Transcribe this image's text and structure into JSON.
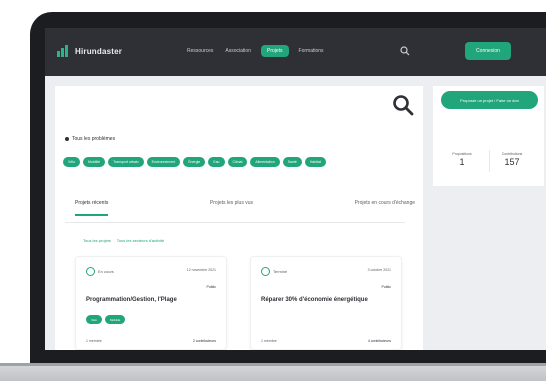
{
  "brand": {
    "name": "Hirundaster"
  },
  "nav": {
    "items": [
      "Ressources",
      "Association",
      "Projets",
      "Formations"
    ],
    "active_index": 2,
    "cta_label": "Connexion"
  },
  "main": {
    "theme_label": "Tous les problèmes",
    "chips": [
      "Vélo",
      "Mobilité",
      "Transport urbain",
      "Environnement",
      "Énergie",
      "Eau",
      "Climat",
      "Alimentation",
      "Santé",
      "Habitat"
    ],
    "tabs": [
      "Projets récents",
      "Projets les plus vus",
      "Projets en cours d'échange"
    ],
    "active_tab": 0,
    "filters": [
      "Tous les projets",
      "Tous les secteurs d'activité"
    ]
  },
  "cards": [
    {
      "status": "En cours",
      "date": "12 novembre 2021",
      "visibility": "Public",
      "title": "Programmation/Gestion, l'Plage",
      "tags": [
        "Vélo",
        "Mobilité"
      ],
      "meta_left": "1 membre",
      "meta_right": "2 contributeurs"
    },
    {
      "status": "Terminé",
      "date": "3 octobre 2021",
      "visibility": "Public",
      "title": "Réparer 30% d'économie énergétique",
      "tags": [],
      "meta_left": "1 membre",
      "meta_right": "4 contributeurs"
    }
  ],
  "side": {
    "cta_label": "Proposer un projet / Faire un don",
    "stats": [
      {
        "label": "Propositions",
        "value": "1"
      },
      {
        "label": "Contributions",
        "value": "157"
      }
    ]
  },
  "colors": {
    "accent": "#21a57a",
    "nav_bg": "#2e3036",
    "frame": "#1b1d21"
  }
}
